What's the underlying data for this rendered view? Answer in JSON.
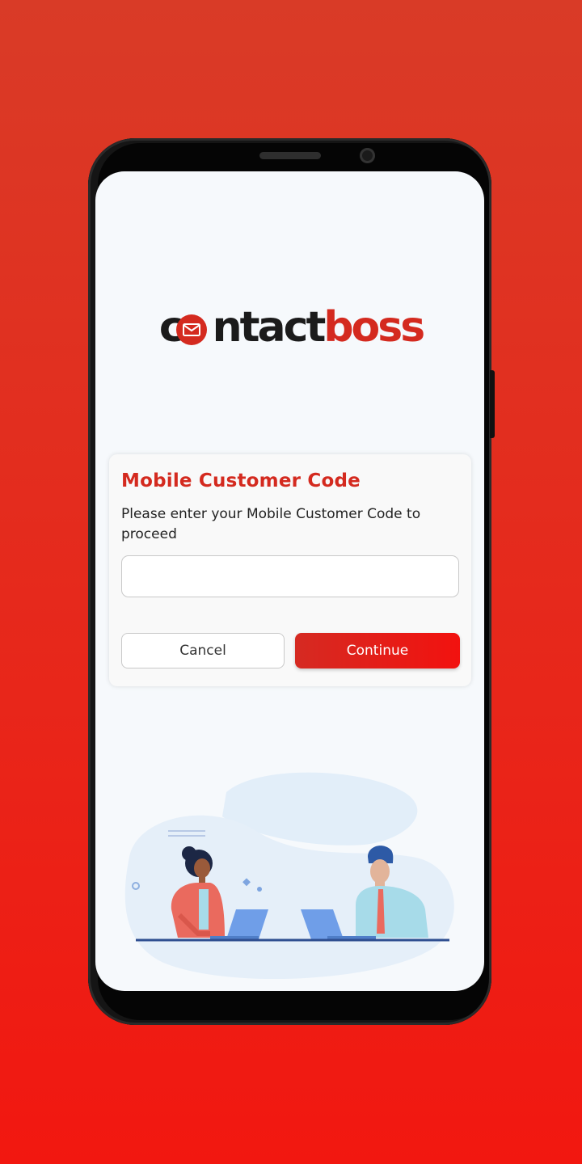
{
  "app": {
    "logo_part1": "c",
    "logo_part2": "ntact",
    "logo_part3": "boss"
  },
  "dialog": {
    "title": "Mobile Customer Code",
    "description": "Please enter your Mobile Customer Code to proceed",
    "input_value": "",
    "input_placeholder": "",
    "cancel_label": "Cancel",
    "continue_label": "Continue"
  },
  "colors": {
    "brand_red": "#d42a1f",
    "background_top": "#d93b27",
    "background_bottom": "#f21710"
  },
  "icons": [
    "mail-icon"
  ]
}
